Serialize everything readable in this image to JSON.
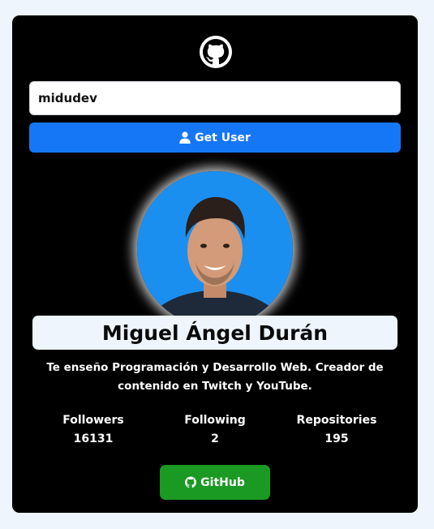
{
  "header": {
    "logo_icon": "github-icon"
  },
  "search": {
    "value": "midudev",
    "placeholder": ""
  },
  "get_user_button": {
    "label": "Get User",
    "icon": "user-icon",
    "color": "#1677f6"
  },
  "profile": {
    "name": "Miguel Ángel Durán",
    "bio": "Te enseño Programación y Desarrollo Web. Creador de contenido en Twitch y YouTube.",
    "avatar_background": "#1a8ff0"
  },
  "stats": [
    {
      "label": "Followers",
      "value": "16131"
    },
    {
      "label": "Following",
      "value": "2"
    },
    {
      "label": "Repositories",
      "value": "195"
    }
  ],
  "github_button": {
    "label": "GitHub",
    "icon": "github-icon",
    "color": "#1a9a22"
  },
  "colors": {
    "page_background": "#eef5fd",
    "card_background": "#000000"
  }
}
